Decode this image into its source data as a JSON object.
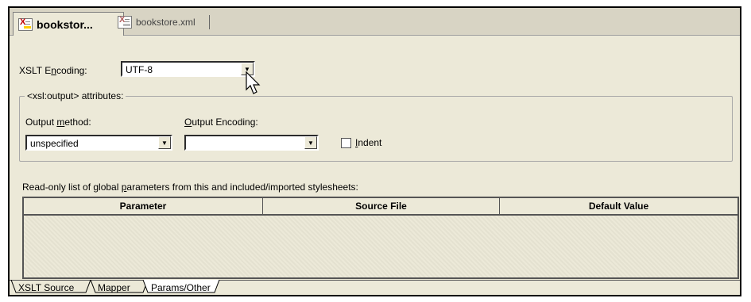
{
  "editor_tabs": [
    {
      "label": "bookstor...",
      "active": true
    },
    {
      "label": "bookstore.xml",
      "active": false
    }
  ],
  "xslt_encoding": {
    "label_pre": "XSLT E",
    "label_key": "n",
    "label_post": "coding:",
    "value": "UTF-8"
  },
  "output_group": {
    "title": "<xsl:output> attributes:",
    "method": {
      "label_pre": "Output ",
      "label_key": "m",
      "label_post": "ethod:",
      "value": "unspecified"
    },
    "encoding": {
      "label_key": "O",
      "label_post": "utput Encoding:",
      "value": ""
    },
    "indent": {
      "label_key": "I",
      "label_post": "ndent",
      "checked": false
    }
  },
  "params": {
    "caption_pre": "Read-only list of global ",
    "caption_key": "p",
    "caption_post": "arameters from this and included/imported stylesheets:",
    "columns": [
      "Parameter",
      "Source File",
      "Default Value"
    ],
    "rows": []
  },
  "sheet_tabs": [
    "XSLT Source",
    "Mapper",
    "Params/Other"
  ],
  "selected_sheet": "Params/Other",
  "icons": {
    "xml_file": "xml-file-icon",
    "dropdown": "chevron-down-icon",
    "cursor": "mouse-pointer-icon"
  }
}
